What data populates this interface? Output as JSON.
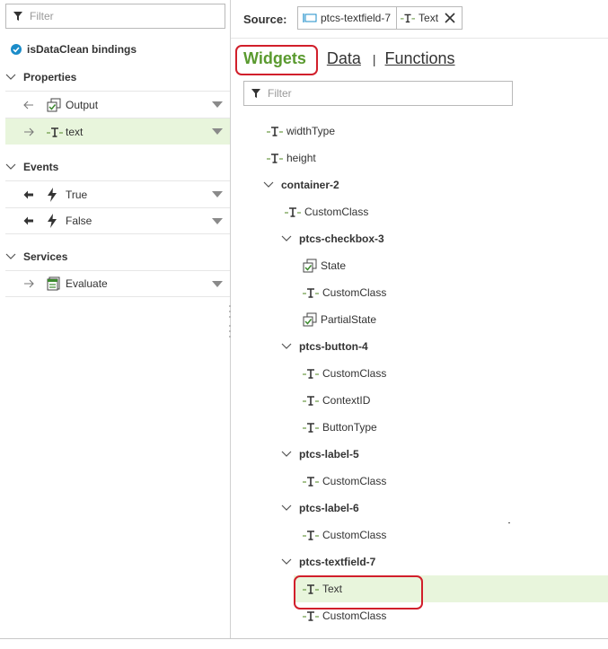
{
  "left_panel": {
    "filter_placeholder": "Filter",
    "title": "isDataClean bindings",
    "sections": {
      "properties": {
        "label": "Properties",
        "items": [
          {
            "label": "Output",
            "icon": "boolean-icon",
            "direction": "out"
          },
          {
            "label": "text",
            "icon": "text-type-icon",
            "direction": "in",
            "selected": true
          }
        ]
      },
      "events": {
        "label": "Events",
        "items": [
          {
            "label": "True",
            "icon": "lightning-icon",
            "direction": "out"
          },
          {
            "label": "False",
            "icon": "lightning-icon",
            "direction": "out"
          }
        ]
      },
      "services": {
        "label": "Services",
        "items": [
          {
            "label": "Evaluate",
            "icon": "service-icon",
            "direction": "in"
          }
        ]
      }
    }
  },
  "right_panel": {
    "source_label": "Source:",
    "source_widget": "ptcs-textfield-7",
    "source_property": "Text",
    "tabs": {
      "widgets": "Widgets",
      "data": "Data",
      "separator": "|",
      "functions": "Functions"
    },
    "filter_placeholder": "Filter",
    "tree": [
      {
        "label": "widthType",
        "type": "text"
      },
      {
        "label": "height",
        "type": "text"
      },
      {
        "label": "container-2",
        "type": "group"
      },
      {
        "label": "CustomClass",
        "type": "text"
      },
      {
        "label": "ptcs-checkbox-3",
        "type": "group"
      },
      {
        "label": "State",
        "type": "bool"
      },
      {
        "label": "CustomClass",
        "type": "text"
      },
      {
        "label": "PartialState",
        "type": "bool"
      },
      {
        "label": "ptcs-button-4",
        "type": "group"
      },
      {
        "label": "CustomClass",
        "type": "text"
      },
      {
        "label": "ContextID",
        "type": "text"
      },
      {
        "label": "ButtonType",
        "type": "text"
      },
      {
        "label": "ptcs-label-5",
        "type": "group"
      },
      {
        "label": "CustomClass",
        "type": "text"
      },
      {
        "label": "ptcs-label-6",
        "type": "group"
      },
      {
        "label": "CustomClass",
        "type": "text"
      },
      {
        "label": "ptcs-textfield-7",
        "type": "group"
      },
      {
        "label": "Text",
        "type": "text",
        "selected": true
      },
      {
        "label": "CustomClass",
        "type": "text"
      }
    ]
  },
  "colors": {
    "accent_green": "#5a9a2f",
    "selection_bg": "#e8f5dc",
    "highlight_red": "#d11f2b",
    "check_blue": "#1b8cc9"
  }
}
